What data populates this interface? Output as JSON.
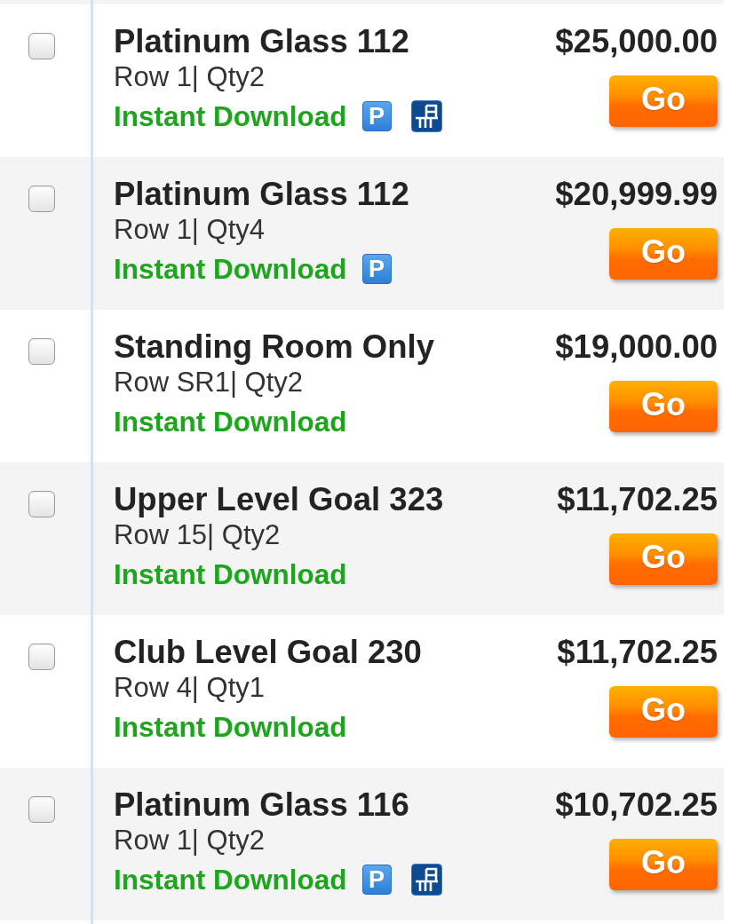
{
  "listings": [
    {
      "checked": false,
      "section": "Platinum Glass 112",
      "details": "Row 1| Qty2",
      "delivery": "Instant Download",
      "icons": [
        {
          "kind": "parking",
          "symbol": "P"
        },
        {
          "kind": "seat_map"
        }
      ],
      "price": "$25,000.00",
      "button": "Go"
    },
    {
      "checked": false,
      "section": "Platinum Glass 112",
      "details": "Row 1| Qty4",
      "delivery": "Instant Download",
      "icons": [
        {
          "kind": "parking",
          "symbol": "P"
        }
      ],
      "price": "$20,999.99",
      "button": "Go"
    },
    {
      "checked": false,
      "section": "Standing Room Only",
      "details": "Row SR1| Qty2",
      "delivery": "Instant Download",
      "price": "$19,000.00",
      "button": "Go"
    },
    {
      "checked": false,
      "section": "Upper Level Goal 323",
      "details": "Row 15| Qty2",
      "delivery": "Instant Download",
      "price": "$11,702.25",
      "button": "Go"
    },
    {
      "checked": false,
      "section": "Club Level Goal 230",
      "details": "Row 4| Qty1",
      "delivery": "Instant Download",
      "price": "$11,702.25",
      "button": "Go"
    },
    {
      "checked": false,
      "section": "Platinum Glass 116",
      "details": "Row 1| Qty2",
      "delivery": "Instant Download",
      "icons": [
        {
          "kind": "parking",
          "symbol": "P"
        },
        {
          "kind": "seat_map"
        }
      ],
      "price": "$10,702.25",
      "button": "Go"
    }
  ]
}
